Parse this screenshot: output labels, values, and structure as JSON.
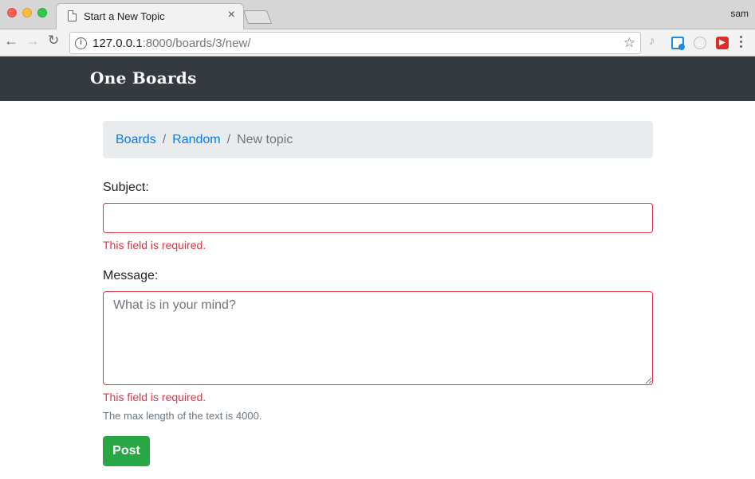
{
  "browser": {
    "tab_title": "Start a New Topic",
    "tab_close": "×",
    "profile_name": "sam",
    "url_host": "127.0.0.1",
    "url_rest": ":8000/boards/3/new/",
    "info_glyph": "i",
    "star_glyph": "☆",
    "ext_music_glyph": "♪",
    "ext_red_glyph": "▶"
  },
  "navbar": {
    "brand": "One Boards"
  },
  "breadcrumb": {
    "items": [
      "Boards",
      "Random"
    ],
    "separator": "/",
    "active": "New topic"
  },
  "form": {
    "subject_label": "Subject:",
    "subject_value": "",
    "subject_error": "This field is required.",
    "message_label": "Message:",
    "message_placeholder": "What is in your mind?",
    "message_error": "This field is required.",
    "message_help": "The max length of the text is 4000.",
    "submit_label": "Post"
  },
  "colors": {
    "navbar_bg": "#343a40",
    "link": "#007bff",
    "error": "#dc3545",
    "success": "#28a745",
    "breadcrumb_bg": "#e9ecef"
  }
}
